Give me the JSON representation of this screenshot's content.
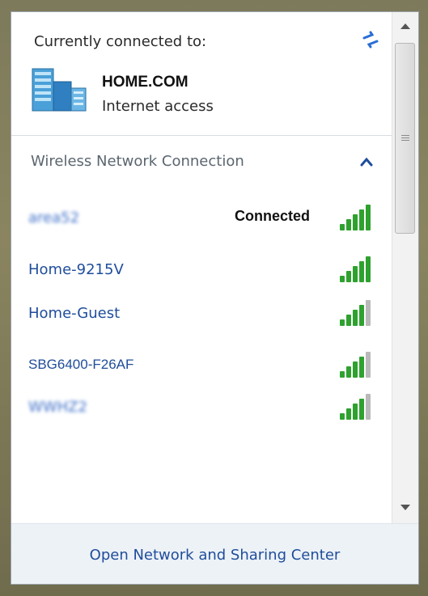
{
  "current": {
    "label": "Currently connected to:",
    "network_name": "HOME.COM",
    "access": "Internet access",
    "icon": "network-building-icon"
  },
  "section": {
    "title": "Wireless Network Connection",
    "collapse_icon": "chevron-up-icon"
  },
  "networks": [
    {
      "name": "area52",
      "status": "Connected",
      "signal_bars": 5,
      "blurred": true
    },
    {
      "name": "Home-9215V",
      "status": "",
      "signal_bars": 5,
      "blurred": false
    },
    {
      "name": "Home-Guest",
      "status": "",
      "signal_bars": 4,
      "blurred": false
    },
    {
      "name": "SBG6400-F26AF",
      "status": "",
      "signal_bars": 4,
      "blurred": false
    },
    {
      "name": "WWHZ2",
      "status": "",
      "signal_bars": 4,
      "blurred": true
    }
  ],
  "footer": {
    "link": "Open Network and Sharing Center"
  },
  "colors": {
    "link": "#1f4d9b",
    "signal_active": "#2fa12f",
    "signal_inactive": "#b9b9b9",
    "accent": "#2a6ed6"
  }
}
